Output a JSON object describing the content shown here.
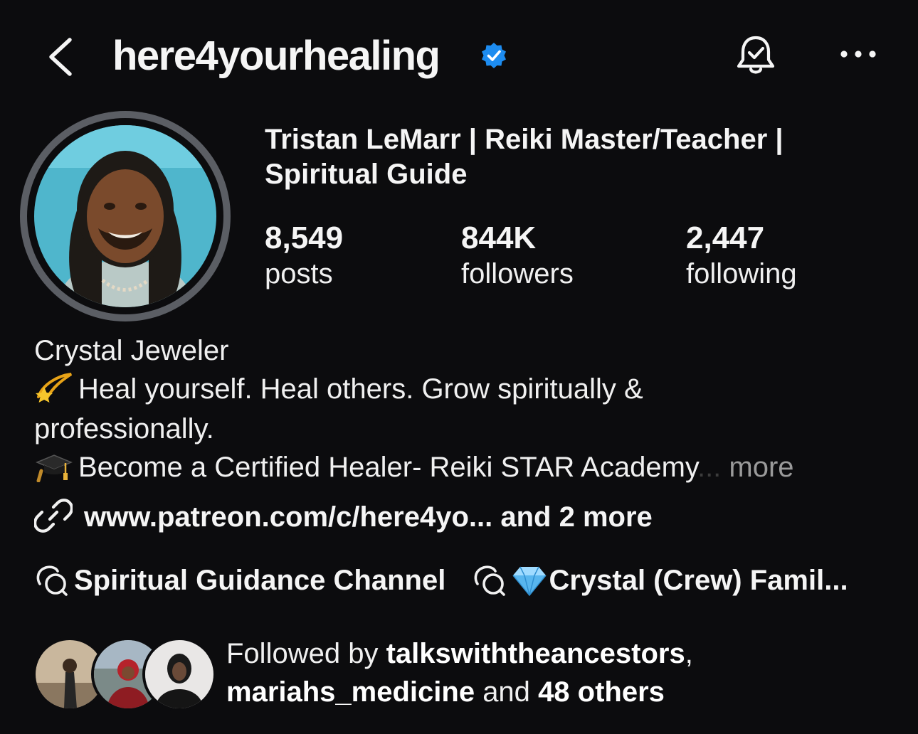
{
  "header": {
    "username": "here4yourhealing",
    "icons": [
      "back-chevron-icon",
      "verified-badge-icon",
      "bell-icon",
      "more-options-icon"
    ]
  },
  "profile": {
    "full_name": "Tristan LeMarr | Reiki Master/Teacher | Spiritual Guide",
    "stats": {
      "posts": {
        "value": "8,549",
        "label": "posts"
      },
      "followers": {
        "value": "844K",
        "label": "followers"
      },
      "following": {
        "value": "2,447",
        "label": "following"
      }
    }
  },
  "bio": {
    "line1": "Crystal Jeweler",
    "line2": "Heal yourself. Heal others. Grow spiritually &",
    "line3": "professionally.",
    "line4": "Become a Certified Healer- Reiki STAR Academy",
    "ellipsis": "...",
    "more": "more"
  },
  "link": {
    "url": "www.patreon.com/c/here4yo...",
    "extra": "and 2 more"
  },
  "channels": [
    {
      "label": "Spiritual Guidance Channel"
    },
    {
      "label": "Crystal (Crew) Famil..."
    }
  ],
  "followed_by": {
    "prefix": "Followed by",
    "user1": "talkswiththeancestors",
    "comma": ",",
    "user2": "mariahs_medicine",
    "middle": "and",
    "others": "48 others"
  },
  "colors": {
    "background": "#0c0c0e",
    "verified_blue": "#1d8cf0",
    "muted_text": "#9a9a9a"
  }
}
